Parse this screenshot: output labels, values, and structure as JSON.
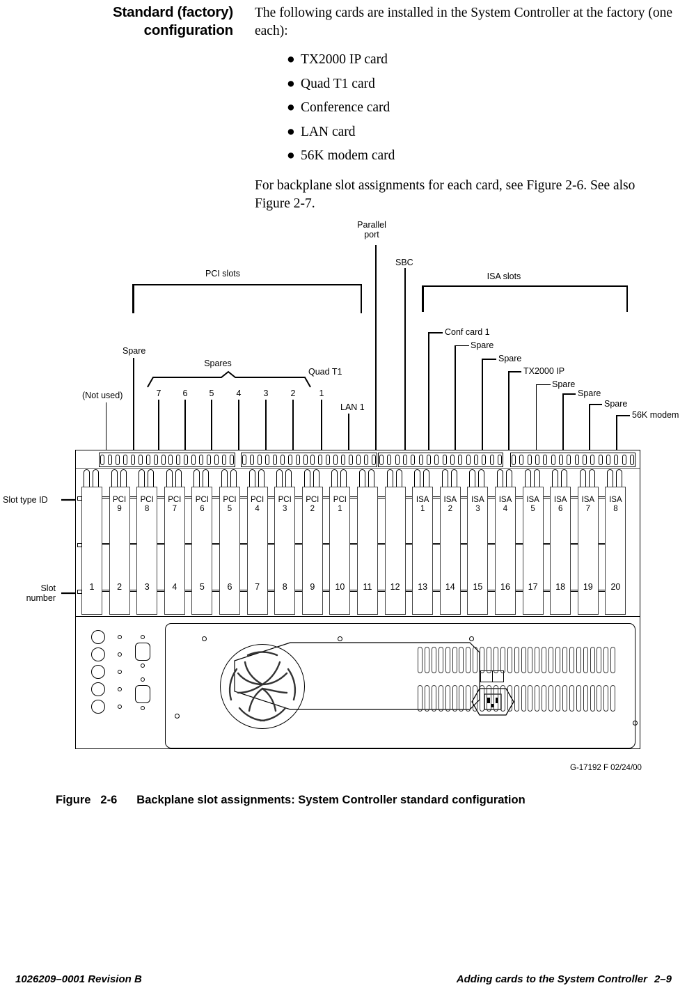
{
  "section": {
    "heading_line1": "Standard (factory)",
    "heading_line2": "configuration",
    "intro": "The following cards are installed in the System Controller at the factory (one each):",
    "bullets": [
      "TX2000 IP card",
      "Quad T1 card",
      "Conference card",
      "LAN card",
      "56K modem card"
    ],
    "closing": "For backplane slot assignments for each card, see Figure 2-6. See also Figure 2-7."
  },
  "figure": {
    "brackets": {
      "pci_slots": "PCI slots",
      "isa_slots": "ISA slots"
    },
    "top_labels": {
      "parallel_port_line1": "Parallel",
      "parallel_port_line2": "port",
      "sbc": "SBC"
    },
    "pci_callouts": {
      "not_used": "(Not used)",
      "spare": "Spare",
      "spares": "Spares",
      "quad_t1": "Quad T1",
      "lan1": "LAN 1",
      "numbers": [
        "7",
        "6",
        "5",
        "4",
        "3",
        "2",
        "1"
      ]
    },
    "isa_callouts": [
      "Conf card 1",
      "Spare",
      "Spare",
      "TX2000 IP",
      "Spare",
      "Spare",
      "Spare",
      "56K modem"
    ],
    "left_labels": {
      "slot_type_id": "Slot type ID",
      "slot_number_line1": "Slot",
      "slot_number_line2": "number"
    },
    "slot_type_ids": [
      "",
      "PCI 9",
      "PCI 8",
      "PCI 7",
      "PCI 6",
      "PCI 5",
      "PCI 4",
      "PCI 3",
      "PCI 2",
      "PCI 1",
      "",
      "",
      "ISA 1",
      "ISA 2",
      "ISA 3",
      "ISA 4",
      "ISA 5",
      "ISA 6",
      "ISA 7",
      "ISA 8"
    ],
    "slot_numbers": [
      "1",
      "2",
      "3",
      "4",
      "5",
      "6",
      "7",
      "8",
      "9",
      "10",
      "11",
      "12",
      "13",
      "14",
      "15",
      "16",
      "17",
      "18",
      "19",
      "20"
    ],
    "drawing_id": "G-17192 F 02/24/00"
  },
  "caption": {
    "label": "Figure",
    "number": "2-6",
    "text": "Backplane slot assignments: System Controller standard configuration"
  },
  "footer": {
    "left": "1026209–0001  Revision B",
    "right_text": "Adding cards to the System Controller",
    "right_page": "2–9"
  }
}
